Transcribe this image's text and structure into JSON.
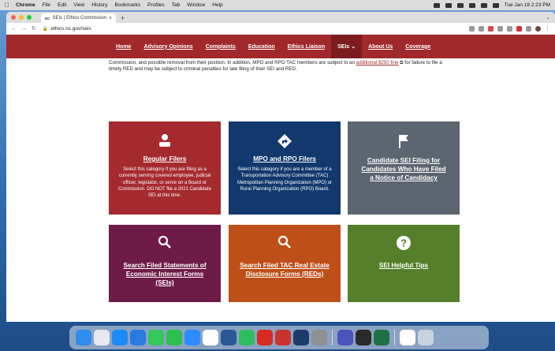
{
  "menubar": {
    "app": "Chrome",
    "items": [
      "File",
      "Edit",
      "View",
      "History",
      "Bookmarks",
      "Profiles",
      "Tab",
      "Window",
      "Help"
    ],
    "clock": "Tue Jan 18 2:23 PM"
  },
  "browser": {
    "tab_title": "SEIs | Ethics Commission",
    "tab_favicon": "NC",
    "url": "ethics.nc.gov/seis"
  },
  "sitenav": {
    "items": [
      "Home",
      "Advisory Opinions",
      "Complaints",
      "Education",
      "Ethics Liaison",
      "SEIs",
      "About Us",
      "Coverage"
    ]
  },
  "intro": {
    "text_before": "Commission, and possible removal from their position. In addition, MPO and RPO TAC members are subject to an ",
    "link": "additional $250 fine",
    "text_after": " for failure to file a timely RED and may be subject to criminal penalties for late filing of their SEI and RED."
  },
  "cards": [
    {
      "title": "Regular Filers",
      "desc": "Select this category if you are filing as a currently serving covered employee, judicial officer, legislator, or serve on a Board or Commission. DO NOT file a 2021 Candidate SEI at this time.",
      "icon": "person-icon",
      "color": "#a52a2e"
    },
    {
      "title": "MPO and RPO Filers",
      "desc": "Select this category if you are a member of a Transportation Advisory Committee (TAC) Metropolitan Planning Organization (MPO) or Rural Planning Organization (RPO) Board.",
      "icon": "direction-sign-icon",
      "color": "#12386e"
    },
    {
      "title": "Candidate SEI Filing for Candidates Who Have Filed a Notice of Candidacy",
      "desc": "",
      "icon": "flag-icon",
      "color": "#5c6670"
    },
    {
      "title": "Search Filed Statements of Economic Interest Forms (SEIs)",
      "desc": "",
      "icon": "search-icon",
      "color": "#6e1b47"
    },
    {
      "title": "Search Filed TAC Real Estate Disclosure Forms (REDs)",
      "desc": "",
      "icon": "search-icon",
      "color": "#be4f18"
    },
    {
      "title": "SEI Helpful Tips",
      "desc": "",
      "icon": "question-icon",
      "color": "#557f2a"
    }
  ],
  "dock": {
    "icons": [
      "finder",
      "launchpad",
      "app-store",
      "icloud",
      "messages",
      "facetime",
      "zoom",
      "chrome",
      "word",
      "evernote",
      "acrobat",
      "stack",
      "preview",
      "settings",
      "teams",
      "record",
      "excel",
      "files",
      "trash"
    ],
    "colors": [
      "#2f8cf0",
      "#e8e8f0",
      "#1b8cf5",
      "#2a7ae2",
      "#34c759",
      "#2fbf4f",
      "#2d8cff",
      "#ffffff",
      "#2b5797",
      "#2dbe60",
      "#d62a22",
      "#c8332e",
      "#1b3c6b",
      "#8e8e93",
      "#4b53bc",
      "#2a2a2a",
      "#1e7145",
      "#ffffff",
      "#c9d3de"
    ]
  }
}
